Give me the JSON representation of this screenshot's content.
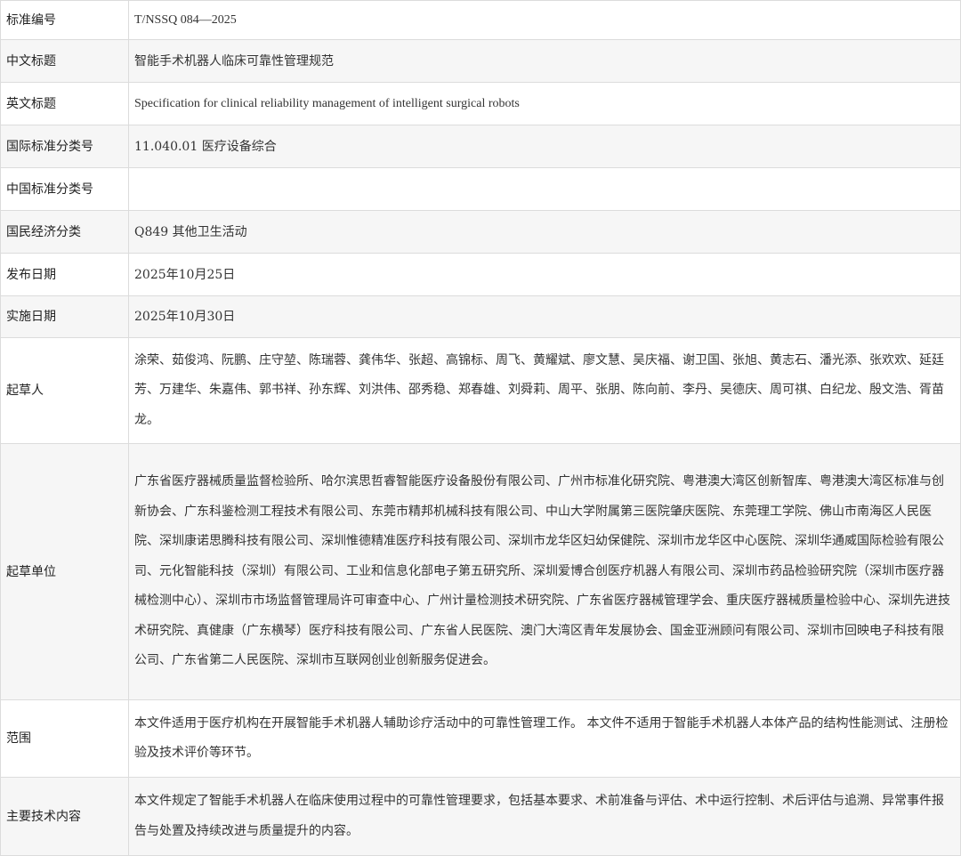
{
  "rows": [
    {
      "label": "标准编号",
      "value": "T/NSSQ 084—2025"
    },
    {
      "label": "中文标题",
      "value": "智能手术机器人临床可靠性管理规范"
    },
    {
      "label": "英文标题",
      "value": "Specification for clinical reliability management of intelligent surgical robots"
    },
    {
      "label": "国际标准分类号",
      "value": "11.040.01 医疗设备综合"
    },
    {
      "label": "中国标准分类号",
      "value": ""
    },
    {
      "label": "国民经济分类",
      "value": "Q849 其他卫生活动"
    },
    {
      "label": "发布日期",
      "value": "2025年10月25日"
    },
    {
      "label": "实施日期",
      "value": "2025年10月30日"
    },
    {
      "label": "起草人",
      "value": "涂荣、茹俊鸿、阮鹏、庄守堃、陈瑞蓉、龚伟华、张超、高锦标、周飞、黄耀斌、廖文慧、吴庆福、谢卫国、张旭、黄志石、潘光添、张欢欢、延廷芳、万建华、朱嘉伟、郭书祥、孙东辉、刘洪伟、邵秀稳、郑春雄、刘舜莉、周平、张朋、陈向前、李丹、吴德庆、周可祺、白纪龙、殷文浩、胥苗龙。"
    },
    {
      "label": "起草单位",
      "value": "广东省医疗器械质量监督检验所、哈尔滨思哲睿智能医疗设备股份有限公司、广州市标准化研究院、粤港澳大湾区创新智库、粤港澳大湾区标准与创新协会、广东科鉴检测工程技术有限公司、东莞市精邦机械科技有限公司、中山大学附属第三医院肇庆医院、东莞理工学院、佛山市南海区人民医院、深圳康诺思腾科技有限公司、深圳惟德精准医疗科技有限公司、深圳市龙华区妇幼保健院、深圳市龙华区中心医院、深圳华通威国际检验有限公司、元化智能科技（深圳）有限公司、工业和信息化部电子第五研究所、深圳爱博合创医疗机器人有限公司、深圳市药品检验研究院（深圳市医疗器械检测中心）、深圳市市场监督管理局许可审查中心、广州计量检测技术研究院、广东省医疗器械管理学会、重庆医疗器械质量检验中心、深圳先进技术研究院、真健康（广东横琴）医疗科技有限公司、广东省人民医院、澳门大湾区青年发展协会、国金亚洲顾问有限公司、深圳市回映电子科技有限公司、广东省第二人民医院、深圳市互联网创业创新服务促进会。"
    },
    {
      "label": "范围",
      "value": "本文件适用于医疗机构在开展智能手术机器人辅助诊疗活动中的可靠性管理工作。 本文件不适用于智能手术机器人本体产品的结构性能测试、注册检验及技术评价等环节。"
    },
    {
      "label": "主要技术内容",
      "value": "本文件规定了智能手术机器人在临床使用过程中的可靠性管理要求，包括基本要求、术前准备与评估、术中运行控制、术后评估与追溯、异常事件报告与处置及持续改进与质量提升的内容。"
    }
  ]
}
